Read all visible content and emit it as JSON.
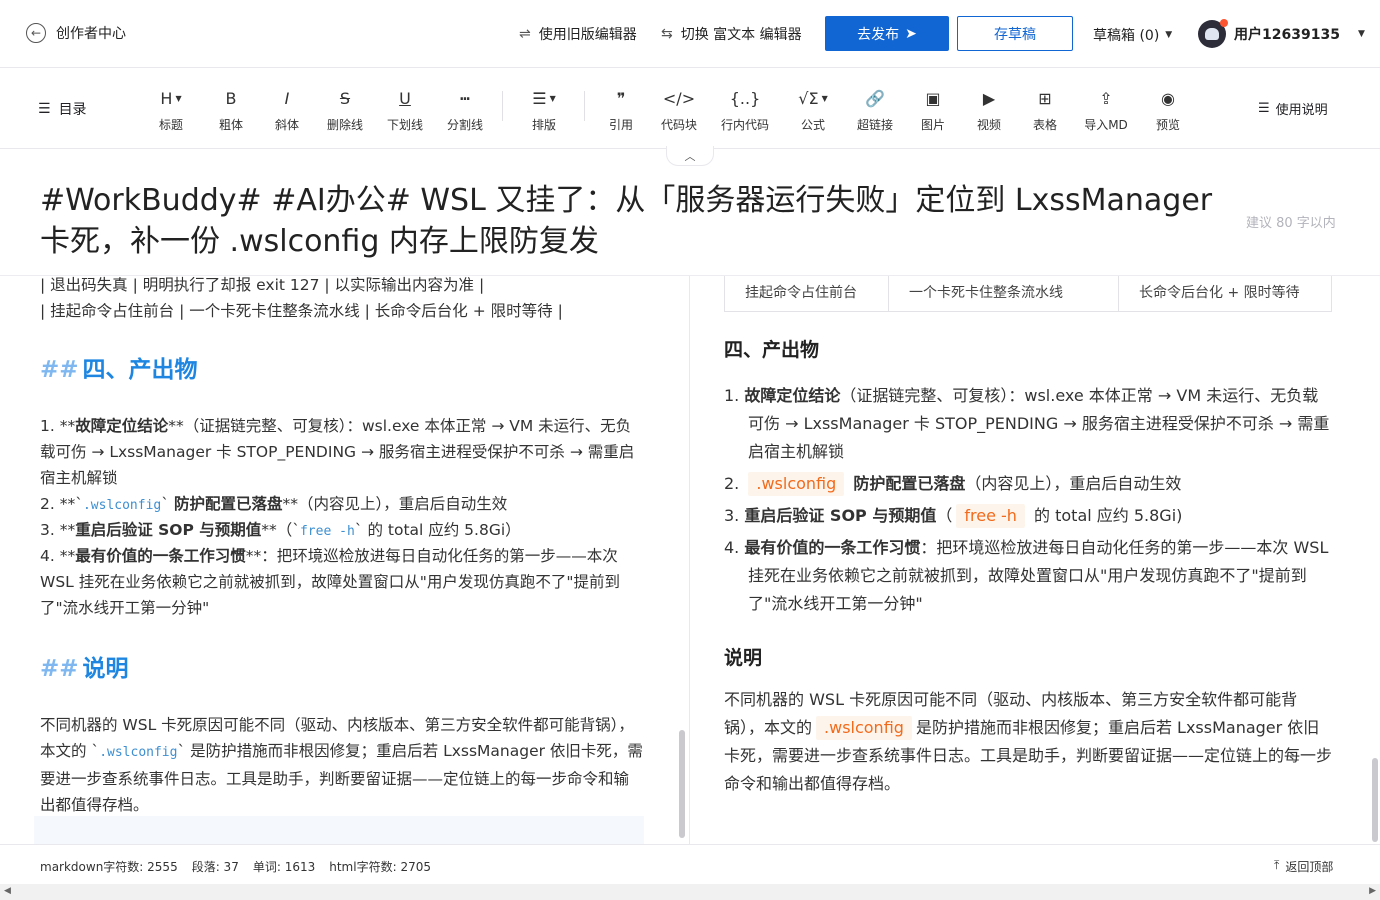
{
  "topbar": {
    "back_label": "创作者中心",
    "old_editor": "使用旧版编辑器",
    "switch_rich": "切换 富文本 编辑器",
    "publish": "去发布",
    "save_draft": "存草稿",
    "drafts": "草稿箱 (0)",
    "username": "用户12639135"
  },
  "toolbar": {
    "toc": "目录",
    "tools": [
      {
        "glyph": "H",
        "label": "标题",
        "icon": "heading-icon"
      },
      {
        "glyph": "B",
        "label": "粗体",
        "icon": "bold-icon"
      },
      {
        "glyph": "I",
        "label": "斜体",
        "icon": "italic-icon"
      },
      {
        "glyph": "S",
        "label": "删除线",
        "icon": "strikethrough-icon"
      },
      {
        "glyph": "U",
        "label": "下划线",
        "icon": "underline-icon"
      },
      {
        "glyph": "┅",
        "label": "分割线",
        "icon": "divider-icon"
      },
      {
        "glyph": "☰",
        "label": "排版",
        "icon": "layout-icon"
      },
      {
        "glyph": "❞",
        "label": "引用",
        "icon": "quote-icon"
      },
      {
        "glyph": "</>",
        "label": "代码块",
        "icon": "code-block-icon"
      },
      {
        "glyph": "{..}",
        "label": "行内代码",
        "icon": "inline-code-icon"
      },
      {
        "glyph": "√Σ",
        "label": "公式",
        "icon": "formula-icon"
      },
      {
        "glyph": "🔗",
        "label": "超链接",
        "icon": "link-icon"
      },
      {
        "glyph": "▣",
        "label": "图片",
        "icon": "image-icon"
      },
      {
        "glyph": "▶",
        "label": "视频",
        "icon": "video-icon"
      },
      {
        "glyph": "⊞",
        "label": "表格",
        "icon": "table-icon"
      },
      {
        "glyph": "⇪",
        "label": "导入MD",
        "icon": "import-md-icon"
      },
      {
        "glyph": "◉",
        "label": "预览",
        "icon": "preview-icon"
      }
    ],
    "help": "使用说明"
  },
  "article": {
    "title": "#WorkBuddy# #AI办公# WSL 又挂了：从「服务器运行失败」定位到 LxssManager 卡死，补一份 .wslconfig 内存上限防复发",
    "title_hint": "建议 80 字以内"
  },
  "editor": {
    "table_line1": "| 退出码失真 | 明明执行了却报 exit 127 | 以实际输出内容为准 |",
    "table_line2": "| 挂起命令占住前台 | 一个卡死卡住整条流水线 | 长命令后台化 + 限时等待 |",
    "h_output": "四、产出物",
    "h_note": "说明",
    "item1_prefix": "1. **",
    "item1_bold": "故障定位结论",
    "item1_rest": "**（证据链完整、可复核）：wsl.exe 本体正常 → VM 未运行、无负载可伤 → LxssManager 卡 STOP_PENDING → 服务宿主进程受保护不可杀 → 需重启宿主机解锁",
    "item2_prefix": "2. **`",
    "item2_code": ".wslconfig",
    "item2_mid": "` ",
    "item2_bold": "防护配置已落盘",
    "item2_rest": "**（内容见上），重启后自动生效",
    "item3_prefix": "3. **",
    "item3_bold": "重启后验证 SOP 与预期值",
    "item3_mid": "**（`",
    "item3_code": "free -h",
    "item3_rest": "` 的 total 应约 5.8Gi）",
    "item4_prefix": "4. **",
    "item4_bold": "最有价值的一条工作习惯",
    "item4_rest": "**：把环境巡检放进每日自动化任务的第一步——本次 WSL 挂死在业务依赖它之前就被抓到，故障处置窗口从\"用户发现仿真跑不了\"提前到了\"流水线开工第一分钟\"",
    "note_a": "不同机器的 WSL 卡死原因可能不同（驱动、内核版本、第三方安全软件都可能背锅），本文的 `",
    "note_code": ".wslconfig",
    "note_b": "` 是防护措施而非根因修复；重启后若 LxssManager 依旧卡死，需要进一步查系统事件日志。工具是助手，判断要留证据——定位链上的每一步命令和输出都值得存档。"
  },
  "preview": {
    "row_c1": "挂起命令占住前台",
    "row_c2": "一个卡死卡住整条流水线",
    "row_c3": "长命令后台化 + 限时等待",
    "h_output": "四、产出物",
    "h_note": "说明",
    "items": [
      {
        "num": "1.",
        "bold": "故障定位结论",
        "rest": "（证据链完整、可复核）：wsl.exe 本体正常 → VM 未运行、无负载可伤 → LxssManager 卡 STOP_PENDING → 服务宿主进程受保护不可杀 → 需重启宿主机解锁"
      },
      {
        "num": "2.",
        "code": ".wslconfig",
        "bold": "防护配置已落盘",
        "rest": "（内容见上），重启后自动生效"
      },
      {
        "num": "3.",
        "bold": "重启后验证 SOP 与预期值",
        "code": "free -h",
        "rest": "的 total 应约 5.8Gi)"
      },
      {
        "num": "4.",
        "bold": "最有价值的一条工作习惯",
        "rest": "：把环境巡检放进每日自动化任务的第一步——本次 WSL 挂死在业务依赖它之前就被抓到，故障处置窗口从\"用户发现仿真跑不了\"提前到了\"流水线开工第一分钟\""
      }
    ],
    "note_a": "不同机器的 WSL 卡死原因可能不同（驱动、内核版本、第三方安全软件都可能背锅），本文的",
    "note_code": ".wslconfig",
    "note_b": "是防护措施而非根因修复；重启后若 LxssManager 依旧卡死，需要进一步查系统事件日志。工具是助手，判断要留证据——定位链上的每一步命令和输出都值得存档。"
  },
  "status": {
    "md_chars": "markdown字符数: 2555",
    "paragraphs": "段落: 37",
    "words": "单词: 1613",
    "html_chars": "html字符数: 2705",
    "back_top": "返回顶部"
  },
  "colors": {
    "accent": "#1266d3",
    "heading": "#1e86e1",
    "inline_code": "#f26a1b"
  }
}
